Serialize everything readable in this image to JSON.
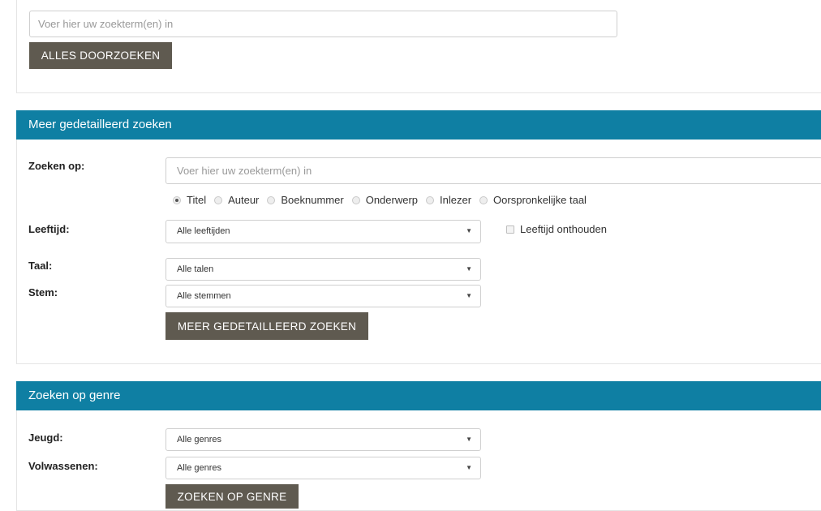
{
  "simple_search": {
    "placeholder": "Voer hier uw zoekterm(en) in",
    "button_label": "ALLES DOORZOEKEN"
  },
  "detailed_search": {
    "header": "Meer gedetailleerd zoeken",
    "search_on_label": "Zoeken op:",
    "search_placeholder": "Voer hier uw zoekterm(en) in",
    "radio_options": [
      {
        "label": "Titel",
        "checked": true
      },
      {
        "label": "Auteur",
        "checked": false
      },
      {
        "label": "Boeknummer",
        "checked": false
      },
      {
        "label": "Onderwerp",
        "checked": false
      },
      {
        "label": "Inlezer",
        "checked": false
      },
      {
        "label": "Oorspronkelijke taal",
        "checked": false
      }
    ],
    "age_label": "Leeftijd:",
    "age_value": "Alle leeftijden",
    "remember_age_label": "Leeftijd onthouden",
    "language_label": "Taal:",
    "language_value": "Alle talen",
    "voice_label": "Stem:",
    "voice_value": "Alle stemmen",
    "button_label": "MEER GEDETAILLEERD ZOEKEN"
  },
  "genre_search": {
    "header": "Zoeken op genre",
    "youth_label": "Jeugd:",
    "youth_value": "Alle genres",
    "adults_label": "Volwassenen:",
    "adults_value": "Alle genres",
    "button_label": "ZOEKEN OP GENRE"
  },
  "icons": {
    "caret": "▼"
  }
}
